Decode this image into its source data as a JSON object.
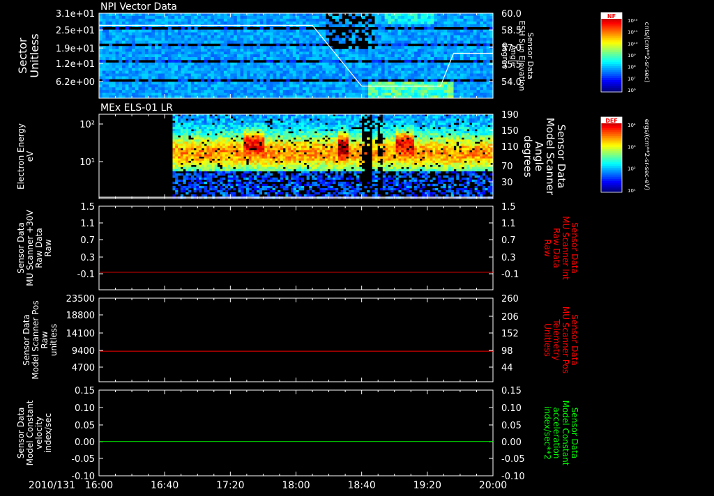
{
  "date_label": "2010/131",
  "time_ticks": [
    "16:00",
    "16:40",
    "17:20",
    "18:00",
    "18:40",
    "19:20",
    "20:00"
  ],
  "colors": {
    "background": "#000000",
    "axis": "#ffffff",
    "red_trace": "#ff0000",
    "green_trace": "#00ff00",
    "title_text": "#ffffff"
  },
  "colorbars": [
    {
      "title": "NF",
      "unit_label": "cnts/(cm**2-sr-sec)",
      "ticks": [
        "10¹²",
        "10¹¹",
        "10¹⁰",
        "10⁹",
        "10⁸",
        "10⁷",
        "10⁶"
      ]
    },
    {
      "title": "DEF",
      "unit_label": "ergs/(cm**2-sr-sec-eV)",
      "ticks": [
        "10⁴",
        "10³",
        "10²",
        "10¹"
      ]
    }
  ],
  "chart_data": [
    {
      "type": "heatmap",
      "title": "NPI Vector Data",
      "ylabel": [
        "Sector",
        "Unitless"
      ],
      "y_ticks": [
        "3.1e+01",
        "2.5e+01",
        "1.9e+01",
        "1.2e+01",
        "6.2e+00"
      ],
      "ylim": [
        0,
        31
      ],
      "right_axis": {
        "label": [
          "Sensor Data",
          "ESH Sun Elevation",
          "Angle",
          "degree"
        ],
        "ticks": [
          "60.0",
          "58.5",
          "57.0",
          "55.5",
          "54.0"
        ],
        "ylim": [
          53.0,
          60.0
        ]
      },
      "overlay_line": {
        "color": "#ffffff",
        "x": [
          "16:00",
          "18:10",
          "18:25",
          "18:40",
          "19:28",
          "19:36",
          "20:00"
        ],
        "y": [
          59.0,
          59.0,
          56.5,
          54.0,
          54.0,
          56.7,
          56.7
        ]
      }
    },
    {
      "type": "heatmap",
      "title": "MEx ELS-01 LR",
      "ylabel": [
        "Electron Energy",
        "eV"
      ],
      "y_ticks": [
        "10²",
        "10¹"
      ],
      "yscale": "log",
      "right_axis": {
        "label": [
          "Sensor Data",
          "Model Scanner",
          "Angle",
          "degrees"
        ],
        "ticks": [
          "190",
          "150",
          "110",
          "70",
          "30"
        ],
        "ylim": [
          0,
          190
        ]
      },
      "overlay_line": {
        "color": "#ffffff",
        "value": 3
      }
    },
    {
      "type": "line",
      "ylabel": [
        "Sensor Data",
        "MU Scanner +30V",
        "Raw Data",
        "Raw"
      ],
      "y_ticks": [
        "1.5",
        "1.1",
        "0.7",
        "0.3",
        "-0.1"
      ],
      "ylim": [
        -0.4,
        1.5
      ],
      "right_axis": {
        "label": [
          "Sensor Data",
          "MU Scanner Int",
          "Raw Data",
          "Raw"
        ],
        "label_color": "#ff0000",
        "ticks": [
          "1.5",
          "1.1",
          "0.7",
          "0.3",
          "-0.1"
        ],
        "ylim": [
          -0.4,
          1.5
        ]
      },
      "series": [
        {
          "color": "#ff0000",
          "constant": 0.0
        }
      ]
    },
    {
      "type": "line",
      "ylabel": [
        "Sensor Data",
        "Model Scanner Pos",
        "Raw",
        "unitless"
      ],
      "y_ticks": [
        "23500",
        "18800",
        "14100",
        "9400",
        "4700"
      ],
      "ylim": [
        0,
        23500
      ],
      "right_axis": {
        "label": [
          "Sensor Data",
          "MU Scanner Pos",
          "Telemetry",
          "Unitless"
        ],
        "label_color": "#ff0000",
        "ticks": [
          "260",
          "206",
          "152",
          "98",
          "44"
        ],
        "ylim": [
          0,
          260
        ]
      },
      "series": [
        {
          "color": "#ff0000",
          "constant": 8600
        }
      ]
    },
    {
      "type": "line",
      "ylabel": [
        "Sensor Data",
        "Model Constant",
        "velocity",
        "index/sec"
      ],
      "y_ticks": [
        "0.15",
        "0.10",
        "0.05",
        "0.00",
        "-0.05",
        "-0.10"
      ],
      "ylim": [
        -0.1,
        0.15
      ],
      "right_axis": {
        "label": [
          "Sensor Data",
          "Model Constant",
          "acceleration",
          "index/sec**2"
        ],
        "label_color": "#00ff00",
        "ticks": [
          "0.15",
          "0.10",
          "0.05",
          "0.00",
          "-0.05",
          "-0.10"
        ],
        "ylim": [
          -0.1,
          0.15
        ]
      },
      "series": [
        {
          "color": "#00ff00",
          "constant": 0.0
        }
      ]
    }
  ]
}
